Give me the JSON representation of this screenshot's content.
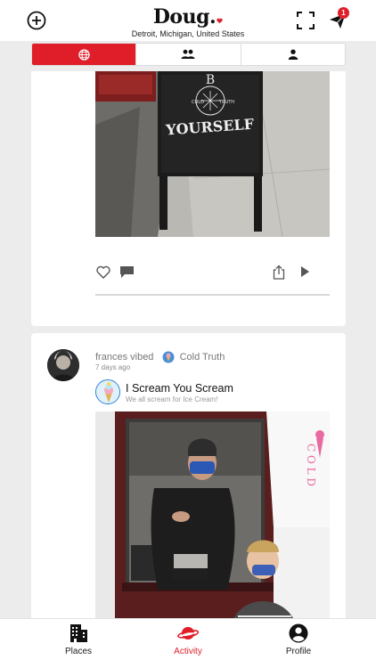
{
  "header": {
    "brand": "Doug.",
    "location": "Detroit, Michigan, United States",
    "notification_count": "1",
    "add_icon": "plus-circle-icon",
    "scan_icon": "scan-frame-icon",
    "notification_icon": "paper-plane-icon"
  },
  "tabs": [
    {
      "icon": "globe-icon",
      "active": true
    },
    {
      "icon": "friends-icon",
      "active": false
    },
    {
      "icon": "person-icon",
      "active": false
    }
  ],
  "feed": {
    "post1": {
      "sign_text_top": "B",
      "sign_text_bottom": "YOURSELF",
      "sign_badge_left": "COLD",
      "sign_badge_right": "TRUTH",
      "actions": [
        "heart-icon",
        "comment-icon",
        "share-icon",
        "play-icon"
      ]
    },
    "post2": {
      "user_action": "frances vibed",
      "place": "Cold Truth",
      "time": "7 days ago",
      "product_title": "I Scream You Scream",
      "product_subtitle": "We all scream for Ice Cream!"
    }
  },
  "bottom_nav": [
    {
      "label": "Places",
      "icon": "building-icon",
      "active": false
    },
    {
      "label": "Activity",
      "icon": "planet-icon",
      "active": true
    },
    {
      "label": "Profile",
      "icon": "profile-icon",
      "active": false
    }
  ],
  "colors": {
    "accent": "#e01e2a",
    "background": "#ececec",
    "card": "#ffffff"
  }
}
